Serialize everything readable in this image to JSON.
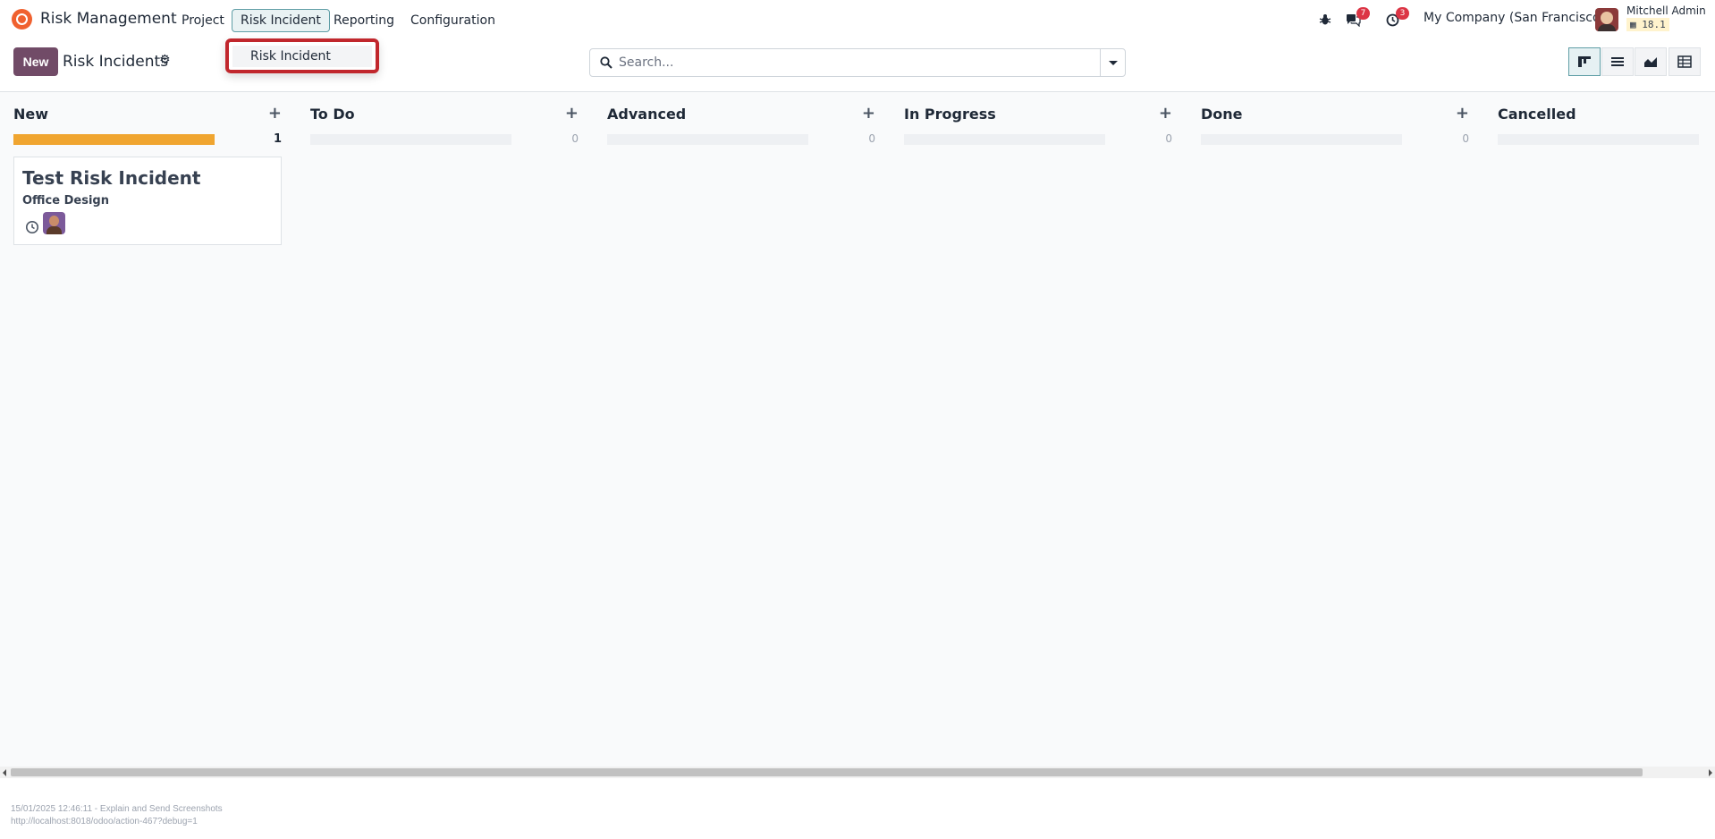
{
  "navbar": {
    "app_name": "Risk Management",
    "menu": [
      "Project",
      "Risk Incident",
      "Reporting",
      "Configuration"
    ],
    "active_menu": "Risk Incident",
    "messages_count": "7",
    "activities_count": "3",
    "company": "My Company (San Francisco)",
    "user_name": "Mitchell Admin",
    "version": "18.1"
  },
  "dropdown": {
    "items": [
      "Risk Incident"
    ]
  },
  "control_panel": {
    "new_label": "New",
    "title": "Risk Incidents",
    "search_placeholder": "Search..."
  },
  "views": [
    "kanban-view-icon",
    "list-view-icon",
    "graph-view-icon",
    "pivot-view-icon"
  ],
  "kanban": {
    "columns": [
      {
        "title": "New",
        "count": "1",
        "progress_fraction": 1.0
      },
      {
        "title": "To Do",
        "count": "0",
        "progress_fraction": 0
      },
      {
        "title": "Advanced",
        "count": "0",
        "progress_fraction": 0
      },
      {
        "title": "In Progress",
        "count": "0",
        "progress_fraction": 0
      },
      {
        "title": "Done",
        "count": "0",
        "progress_fraction": 0
      },
      {
        "title": "Cancelled",
        "count": "",
        "progress_fraction": 0
      }
    ],
    "card": {
      "title": "Test Risk Incident",
      "subtitle": "Office Design"
    }
  },
  "colors": {
    "primary": "#714b67",
    "progress": "#f0a530",
    "highlight": "#c1272d"
  },
  "footer": {
    "line1": "15/01/2025 12:46:11 - Explain and Send Screenshots",
    "line2": "http://localhost:8018/odoo/action-467?debug=1"
  }
}
